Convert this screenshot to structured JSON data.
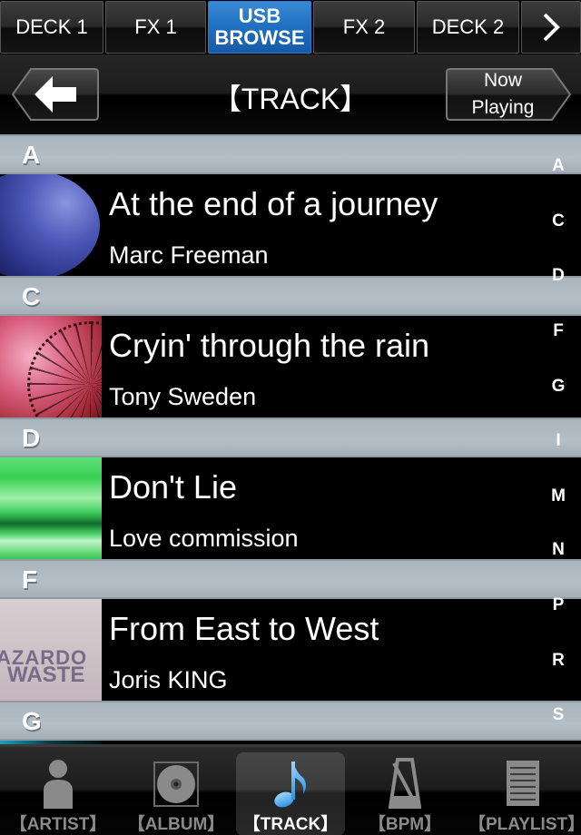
{
  "top_tabs": [
    {
      "label": "DECK 1",
      "active": false
    },
    {
      "label": "FX 1",
      "active": false
    },
    {
      "label_line1": "USB",
      "label_line2": "BROWSE",
      "active": true
    },
    {
      "label": "FX 2",
      "active": false
    },
    {
      "label": "DECK 2",
      "active": false
    },
    {
      "icon": "chevron-right-icon",
      "glyph": "›"
    }
  ],
  "header": {
    "back_icon": "back-arrow-icon",
    "title": "【TRACK】",
    "now_playing_line1": "Now",
    "now_playing_line2": "Playing"
  },
  "sections": [
    {
      "letter": "A",
      "tracks": [
        {
          "title": "At the end of a journey",
          "artist": "Marc Freeman",
          "art": "planet"
        }
      ]
    },
    {
      "letter": "C",
      "tracks": [
        {
          "title": "Cryin' through the rain",
          "artist": "Tony Sweden",
          "art": "ferris-wheel"
        }
      ]
    },
    {
      "letter": "D",
      "tracks": [
        {
          "title": "Don't Lie",
          "artist": "Love commission",
          "art": "green-abstract"
        }
      ]
    },
    {
      "letter": "F",
      "tracks": [
        {
          "title": "From East to West",
          "artist": "Joris KING",
          "art": "hazardous-waste",
          "art_text_1": "AZARDO",
          "art_text_2": "WASTE"
        }
      ]
    },
    {
      "letter": "G",
      "tracks": []
    }
  ],
  "index_letters": [
    "A",
    "C",
    "D",
    "F",
    "G",
    "I",
    "M",
    "N",
    "P",
    "R",
    "S"
  ],
  "bottom_tabs": [
    {
      "label": "【ARTIST】",
      "icon": "person-icon",
      "active": false
    },
    {
      "label": "【ALBUM】",
      "icon": "disc-icon",
      "active": false
    },
    {
      "label": "【TRACK】",
      "icon": "music-note-icon",
      "active": true
    },
    {
      "label": "【BPM】",
      "icon": "metronome-icon",
      "active": false
    },
    {
      "label": "【PLAYLIST】",
      "icon": "playlist-icon",
      "active": false
    }
  ],
  "colors": {
    "active_tab_blue": "#1f6fc0",
    "note_blue": "#4aaef0",
    "section_gray": "#b0bac3",
    "inactive_icon_gray": "#8a8a8a"
  }
}
